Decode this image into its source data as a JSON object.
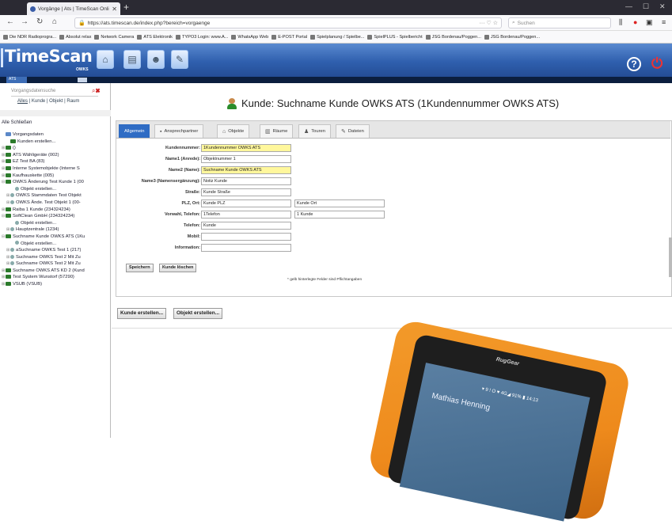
{
  "browser": {
    "tab_title": "Vorgänge | Ats | TimeScan Onli",
    "url": "https://ats.timescan.de/index.php?bereich=vorgaenge",
    "url_actions": "··· ♡ ☆",
    "search_placeholder": "Suchen",
    "bookmarks": [
      "Die NDR Radioprogra...",
      "Absolut relax",
      "Network Camera",
      "ATS Elektronik",
      "TYPO3 Login: www.A...",
      "WhatsApp Web",
      "E-POST Portal",
      "Spielplanung / Spielbe...",
      "SpielPLUS - Spielbericht",
      "JSG Bordenau/Poggen...",
      "JSG Bordenau/Poggen..."
    ]
  },
  "app": {
    "logo": "TimeScan",
    "logo_sub": "OWKS",
    "user_tag": "ATS"
  },
  "left": {
    "search_placeholder": "Vorgangsdatensuche",
    "filter_all": "Alles",
    "filter_rest": " | Kunde | Objekt | Raum",
    "close": "Alle Schließen",
    "tree": [
      {
        "indent": 0,
        "pm": "",
        "icon": "d",
        "label": "Vorgangsdaten"
      },
      {
        "indent": 1,
        "pm": "",
        "icon": "g",
        "label": "Kunden erstellen..."
      },
      {
        "indent": 0,
        "pm": "⊞",
        "icon": "g",
        "label": "()"
      },
      {
        "indent": 0,
        "pm": "⊞",
        "icon": "g",
        "label": "ATS Wähligeräte (002)"
      },
      {
        "indent": 0,
        "pm": "⊞",
        "icon": "g",
        "label": "EZ Test BA (83)"
      },
      {
        "indent": 0,
        "pm": "⊞",
        "icon": "g",
        "label": "Interne Systemobjekte (Interne S"
      },
      {
        "indent": 0,
        "pm": "⊞",
        "icon": "g",
        "label": "Kaufhauskette (005)"
      },
      {
        "indent": 0,
        "pm": "⊟",
        "icon": "g",
        "label": "OWKS Änderung Test Kunde 1 (00"
      },
      {
        "indent": 2,
        "pm": "",
        "icon": "o",
        "label": "Objekt erstellen..."
      },
      {
        "indent": 1,
        "pm": "⊞",
        "icon": "o",
        "label": "OWKS Stammdaten Test Objekt"
      },
      {
        "indent": 1,
        "pm": "⊞",
        "icon": "o",
        "label": "OWKS Ände. Test Objekt 1 (00-"
      },
      {
        "indent": 0,
        "pm": "⊞",
        "icon": "g",
        "label": "Raiba 1 Kunde (234324234)"
      },
      {
        "indent": 0,
        "pm": "⊟",
        "icon": "g",
        "label": "SoftClean GmbH (234324234)"
      },
      {
        "indent": 2,
        "pm": "",
        "icon": "o",
        "label": "Objekt erstellen..."
      },
      {
        "indent": 1,
        "pm": "⊞",
        "icon": "o",
        "label": "Hauptzentrale (1234)"
      },
      {
        "indent": 0,
        "pm": "⊟",
        "icon": "g",
        "label": "Suchname Kunde OWKS ATS (1Ku"
      },
      {
        "indent": 2,
        "pm": "",
        "icon": "o",
        "label": "Objekt erstellen..."
      },
      {
        "indent": 1,
        "pm": "⊞",
        "icon": "o",
        "label": "aSuchname OWKS Test 1 (217)"
      },
      {
        "indent": 1,
        "pm": "⊞",
        "icon": "o",
        "label": "Suchname OWKS Test 2 Mit Zu"
      },
      {
        "indent": 1,
        "pm": "⊞",
        "icon": "o",
        "label": "Suchname OWKS Test 2 Mit Zu"
      },
      {
        "indent": 0,
        "pm": "⊞",
        "icon": "g",
        "label": "Suchname OWKS ATS KD 2 (Kund"
      },
      {
        "indent": 0,
        "pm": "⊞",
        "icon": "g",
        "label": "Test System Wunstorf (57290)"
      },
      {
        "indent": 0,
        "pm": "⊞",
        "icon": "g",
        "label": "VSUB (VSUB)"
      }
    ]
  },
  "main": {
    "title": "Kunde: Suchname Kunde OWKS ATS (1Kundennummer OWKS ATS)",
    "tabs": [
      "Allgemein",
      "Ansprechpartner",
      "Objekte",
      "Räume",
      "Touren",
      "Dateien"
    ],
    "form": {
      "kundennummer_label": "Kundennummer:",
      "kundennummer": "1Kundennummer OWKS ATS",
      "name1_label": "Name1 (Anrede):",
      "name1": "Objektnummer 1",
      "name2_label": "Name2 (Name):",
      "name2": "Suchname Kunde OWKS ATS",
      "name3_label": "Name3 (Namensergänzung):",
      "name3": "Notiz Kunde",
      "strasse_label": "Straße:",
      "strasse": "Kunde Straße",
      "plzort_label": "PLZ, Ort:",
      "plz": "Kunde PLZ",
      "ort": "Kunde Ort",
      "telefon1_label": "Vorwahl, Telefon:",
      "vorwahl": "1Telefon",
      "telefon": "1 Kunde",
      "telefon_label": "Telefon:",
      "telefon2": "Kunde",
      "mobil_label": "Mobil:",
      "mobil": "",
      "info_label": "Information:",
      "info": ""
    },
    "save_label": "Speichern",
    "delete_label": "Kunde löschen",
    "note": "* gelb hinterlegte Felder sind Pflichtangaben",
    "create_customer": "Kunde erstellen...",
    "create_object": "Objekt erstellen..."
  },
  "tablet": {
    "brand": "RugGear",
    "status": "▾ 9 ! O ♥ 4G◢ 91% ▮ 14:13",
    "name": "Mathias Henning"
  },
  "colors": {
    "accent": "#2f6cc4",
    "required": "#fff79c",
    "logo_bg": "#2f5fae",
    "tablet": "#ee8a1c"
  }
}
